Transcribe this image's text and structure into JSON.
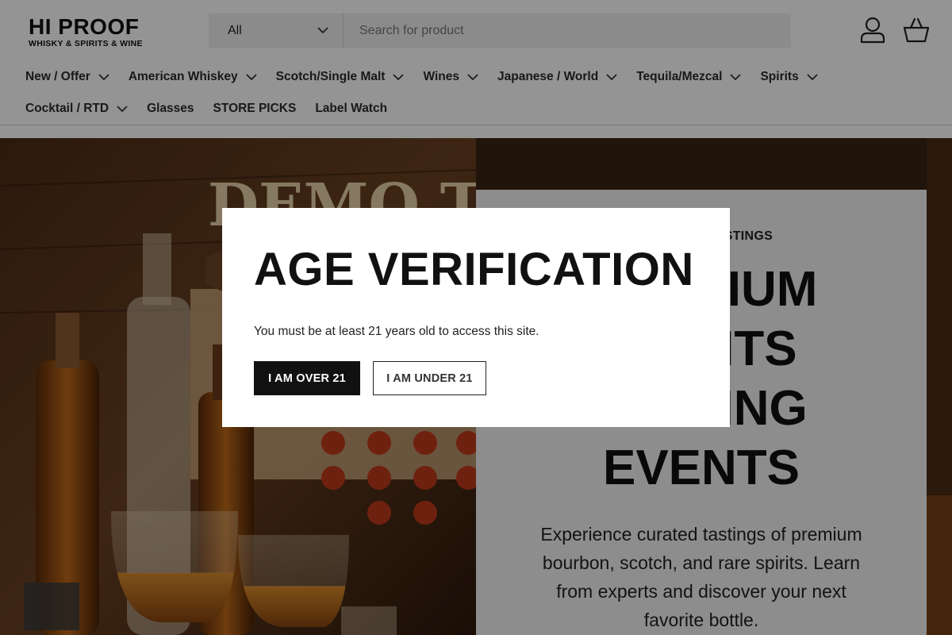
{
  "brand": {
    "name": "HI PROOF",
    "tagline": "WHISKY & SPIRITS & WINE"
  },
  "search": {
    "category": "All",
    "placeholder": "Search for product"
  },
  "icons": {
    "account": "user-account-icon",
    "basket": "shopping-basket-icon",
    "dropdown": "chevron-down-icon"
  },
  "nav": {
    "row1": [
      {
        "label": "New / Offer",
        "dropdown": true
      },
      {
        "label": "American Whiskey",
        "dropdown": true
      },
      {
        "label": "Scotch/Single Malt",
        "dropdown": true
      },
      {
        "label": "Wines",
        "dropdown": true
      },
      {
        "label": "Japanese / World",
        "dropdown": true
      },
      {
        "label": "Tequila/Mezcal",
        "dropdown": true
      },
      {
        "label": "Spirits",
        "dropdown": true
      }
    ],
    "row2": [
      {
        "label": "Cocktail / RTD",
        "dropdown": true
      },
      {
        "label": "Glasses",
        "dropdown": false
      },
      {
        "label": "STORE PICKS",
        "dropdown": false
      },
      {
        "label": "Label Watch",
        "dropdown": false
      }
    ]
  },
  "hero": {
    "image_text": "DEMO TASTING",
    "kicker": "EXCLUSIVE TASTINGS",
    "title_lines": [
      "PREMIUM",
      "SPIRITS",
      "TASTING",
      "EVENTS"
    ],
    "description": "Experience curated tastings of premium bourbon, scotch, and rare spirits. Learn from experts and discover your next favorite bottle."
  },
  "modal": {
    "title": "AGE VERIFICATION",
    "message": "You must be at least 21 years old to access this site.",
    "confirm_label": "I AM OVER 21",
    "deny_label": "I AM UNDER 21"
  },
  "colors": {
    "overlay": "#000000",
    "primary_button": "#111111",
    "search_bg": "#efefef",
    "hero_panel": "#f3f3f3"
  }
}
